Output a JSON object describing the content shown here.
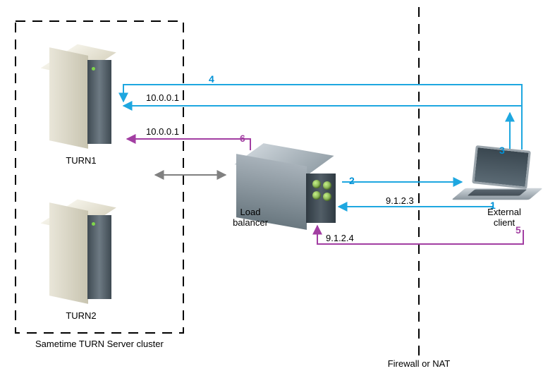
{
  "nodes": {
    "turn1": {
      "label": "TURN1"
    },
    "turn2": {
      "label": "TURN2"
    },
    "cluster_caption": "Sametime TURN Server cluster",
    "load_balancer": {
      "label": "Load\nbalancer"
    },
    "external_client": {
      "label": "External\nclient"
    },
    "firewall_caption": "Firewall or NAT"
  },
  "flows": {
    "f1": {
      "num": "1",
      "ip": "9.1.2.3",
      "color": "blue",
      "desc": "External client → Load balancer"
    },
    "f2": {
      "num": "2",
      "ip": "",
      "color": "blue",
      "desc": "Load balancer → External client"
    },
    "f3": {
      "num": "3",
      "ip": "",
      "color": "blue",
      "desc": "External client up (to top path)"
    },
    "f4": {
      "num": "4",
      "ip": "10.0.0.1",
      "color": "blue",
      "desc": "External client → TURN1 (top path)"
    },
    "f5": {
      "num": "5",
      "ip": "9.1.2.4",
      "color": "purple",
      "desc": "External client → Load balancer (lower)"
    },
    "f6": {
      "num": "6",
      "ip": "10.0.0.1",
      "color": "purple",
      "desc": "Load balancer → TURN1"
    },
    "bidir": {
      "desc": "Cluster ↔ Load balancer (gray double arrow)"
    }
  },
  "colors": {
    "blue": "#1ea7e0",
    "purple": "#a23ea2",
    "gray": "#808080"
  },
  "chart_data": {
    "type": "diagram",
    "title": "TURN server cluster with load balancer behind firewall",
    "nodes": [
      {
        "id": "turn1",
        "label": "TURN1",
        "group": "Sametime TURN Server cluster"
      },
      {
        "id": "turn2",
        "label": "TURN2",
        "group": "Sametime TURN Server cluster"
      },
      {
        "id": "lb",
        "label": "Load balancer"
      },
      {
        "id": "client",
        "label": "External client",
        "side": "outside Firewall/NAT"
      }
    ],
    "edges": [
      {
        "step": 1,
        "from": "client",
        "to": "lb",
        "label": "9.1.2.3",
        "color": "blue"
      },
      {
        "step": 2,
        "from": "lb",
        "to": "client",
        "label": "",
        "color": "blue"
      },
      {
        "step": 3,
        "from": "client",
        "to": "client",
        "label": "",
        "color": "blue",
        "note": "turn upward to direct path"
      },
      {
        "step": 4,
        "from": "client",
        "to": "turn1",
        "label": "10.0.0.1",
        "color": "blue"
      },
      {
        "step": 5,
        "from": "client",
        "to": "lb",
        "label": "9.1.2.4",
        "color": "purple"
      },
      {
        "step": 6,
        "from": "lb",
        "to": "turn1",
        "label": "10.0.0.1",
        "color": "purple"
      },
      {
        "step": null,
        "from": "cluster",
        "to": "lb",
        "label": "",
        "color": "gray",
        "bidirectional": true
      }
    ],
    "partitions": [
      {
        "name": "Sametime TURN Server cluster",
        "contains": [
          "turn1",
          "turn2"
        ]
      },
      {
        "name": "Firewall or NAT",
        "type": "boundary-line"
      }
    ]
  }
}
